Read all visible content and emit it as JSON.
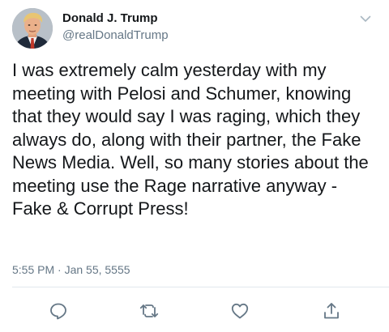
{
  "author": {
    "display_name": "Donald J. Trump",
    "handle": "@realDonaldTrump"
  },
  "tweet": {
    "text": "I was extremely calm yesterday with my meeting with Pelosi and Schumer, knowing that they would say I was raging, which they always do, along with their partner, the Fake News Media. Well, so many stories about the meeting use the Rage narrative anyway - Fake & Corrupt Press!",
    "timestamp": "5:55 PM · Jan 55, 5555"
  },
  "icons": {
    "avatar": "profile-photo",
    "menu": "chevron-down-icon",
    "actions": [
      "reply-icon",
      "retweet-icon",
      "like-icon",
      "share-icon"
    ]
  },
  "colors": {
    "text": "#14171a",
    "secondary": "#657786",
    "icon": "#657786",
    "divider": "#e1e8ed"
  }
}
